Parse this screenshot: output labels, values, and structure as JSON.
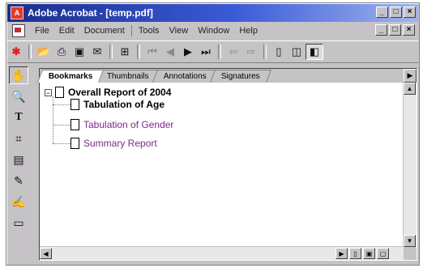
{
  "window": {
    "title": "Adobe Acrobat - [temp.pdf]",
    "app_icon": "acrobat-icon",
    "controls": [
      "_",
      "□",
      "×"
    ]
  },
  "menubar": {
    "items": [
      "File",
      "Edit",
      "Document",
      "Tools",
      "View",
      "Window",
      "Help"
    ],
    "doc_controls": [
      "_",
      "□",
      "×"
    ]
  },
  "toolbar": {
    "icons": {
      "acrobat": "✱",
      "open": "📂",
      "print": "⎙",
      "save": "▣",
      "email": "✉",
      "fit": "⊞",
      "first": "⏮",
      "prev": "◀",
      "next": "▶",
      "last": "⏭",
      "back": "⇦",
      "forward": "⇨",
      "page1": "▯",
      "page2": "◫",
      "page3": "◧"
    }
  },
  "left_tools": {
    "icons": {
      "hand": "✋",
      "zoom": "🔍",
      "text_select": "T",
      "crop": "⌗",
      "note": "▤",
      "pencil": "✎",
      "highlight": "✍",
      "page": "▭"
    }
  },
  "panel": {
    "tabs": [
      "Bookmarks",
      "Thumbnails",
      "Annotations",
      "Signatures"
    ],
    "tab_arrow": "▶",
    "tree": {
      "minus": "−",
      "root": "Overall Report of 2004",
      "children": [
        "Tabulation of Age",
        "Tabulation of Gender",
        "Summary Report"
      ]
    },
    "scroll": {
      "up": "▲",
      "down": "▼",
      "left": "◀",
      "right": "▶"
    }
  },
  "colors": {
    "title_gradient_start": "#1a2f8c",
    "bookmark_link": "#7a2a8a",
    "window_face": "#c6c3c6"
  }
}
